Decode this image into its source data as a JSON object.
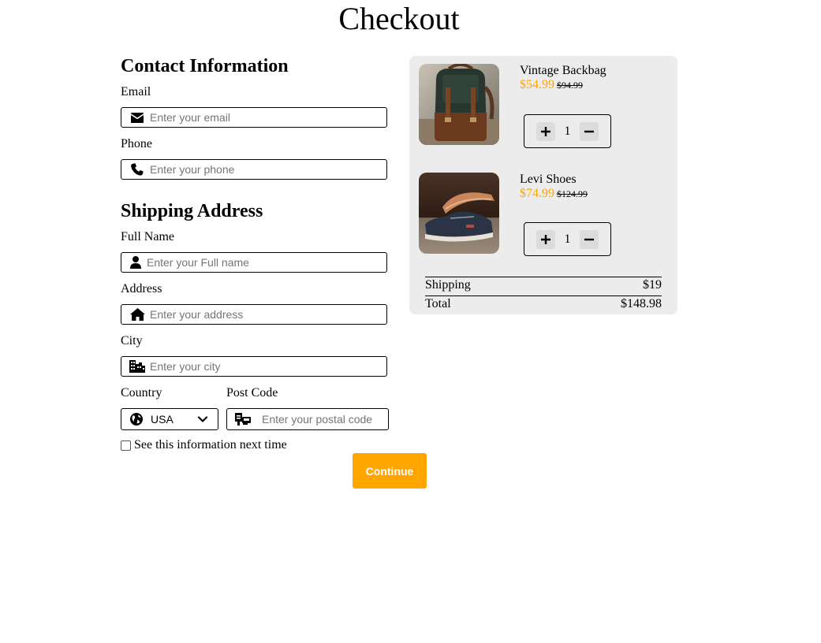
{
  "page": {
    "title": "Checkout"
  },
  "contact": {
    "heading": "Contact Information",
    "email_label": "Email",
    "email_placeholder": "Enter your email",
    "email_value": "",
    "phone_label": "Phone",
    "phone_placeholder": "Enter your phone",
    "phone_value": ""
  },
  "shipping": {
    "heading": "Shipping Address",
    "fullname_label": "Full Name",
    "fullname_placeholder": "Enter your Full name",
    "fullname_value": "",
    "address_label": "Address",
    "address_placeholder": "Enter your address",
    "address_value": "",
    "city_label": "City",
    "city_placeholder": "Enter your city",
    "city_value": "",
    "country_label": "Country",
    "country_value": "USA",
    "postcode_label": "Post Code",
    "postcode_placeholder": "Enter your postal code",
    "postcode_value": "",
    "remember_label": "See this information next time",
    "remember_checked": false
  },
  "actions": {
    "continue_label": "Continue"
  },
  "cart": {
    "items": [
      {
        "name": "Vintage Backbag",
        "price": "$54.99",
        "old_price": "$94.99",
        "quantity": "1",
        "image": "backpack-photo"
      },
      {
        "name": "Levi Shoes",
        "price": "$74.99",
        "old_price": "$124.99",
        "quantity": "1",
        "image": "shoe-photo"
      }
    ],
    "shipping_label": "Shipping",
    "shipping_value": "$19",
    "total_label": "Total",
    "total_value": "$148.98"
  },
  "icons": {
    "email": "envelope-icon",
    "phone": "phone-icon",
    "fullname": "user-icon",
    "address": "home-icon",
    "city": "city-icon",
    "country": "globe-icon",
    "country_dropdown": "chevron-down-icon",
    "postcode": "mailbox-icon",
    "increase": "plus-icon",
    "decrease": "minus-icon"
  },
  "colors": {
    "accent": "#ffa500",
    "cart_background": "#ececec",
    "button_text": "#ffffff"
  }
}
